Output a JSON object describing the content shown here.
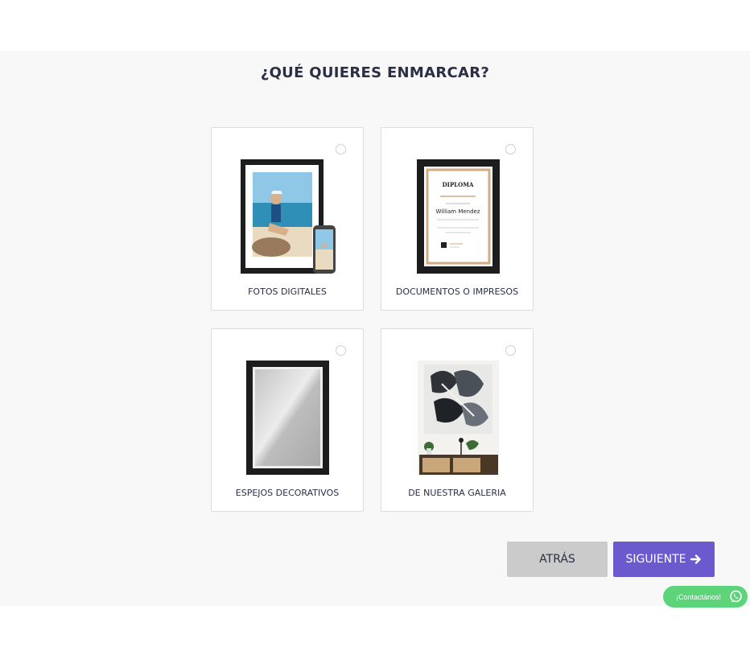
{
  "page": {
    "title": "¿QUÉ QUIERES ENMARCAR?"
  },
  "options": [
    {
      "label": "FOTOS DIGITALES"
    },
    {
      "label": "DOCUMENTOS O IMPRESOS"
    },
    {
      "label": "ESPEJOS DECORATIVOS"
    },
    {
      "label": "DE NUESTRA GALERIA"
    }
  ],
  "diploma": {
    "heading": "DIPLOMA",
    "name": "William Mendez"
  },
  "buttons": {
    "back": "ATRÁS",
    "next": "SIGUIENTE"
  },
  "contact": {
    "label": "¡Contactános!"
  },
  "colors": {
    "accent": "#6a5acd",
    "whatsapp": "#5ed47a",
    "text": "#2a2f45",
    "back_button": "#cbcbcb"
  }
}
